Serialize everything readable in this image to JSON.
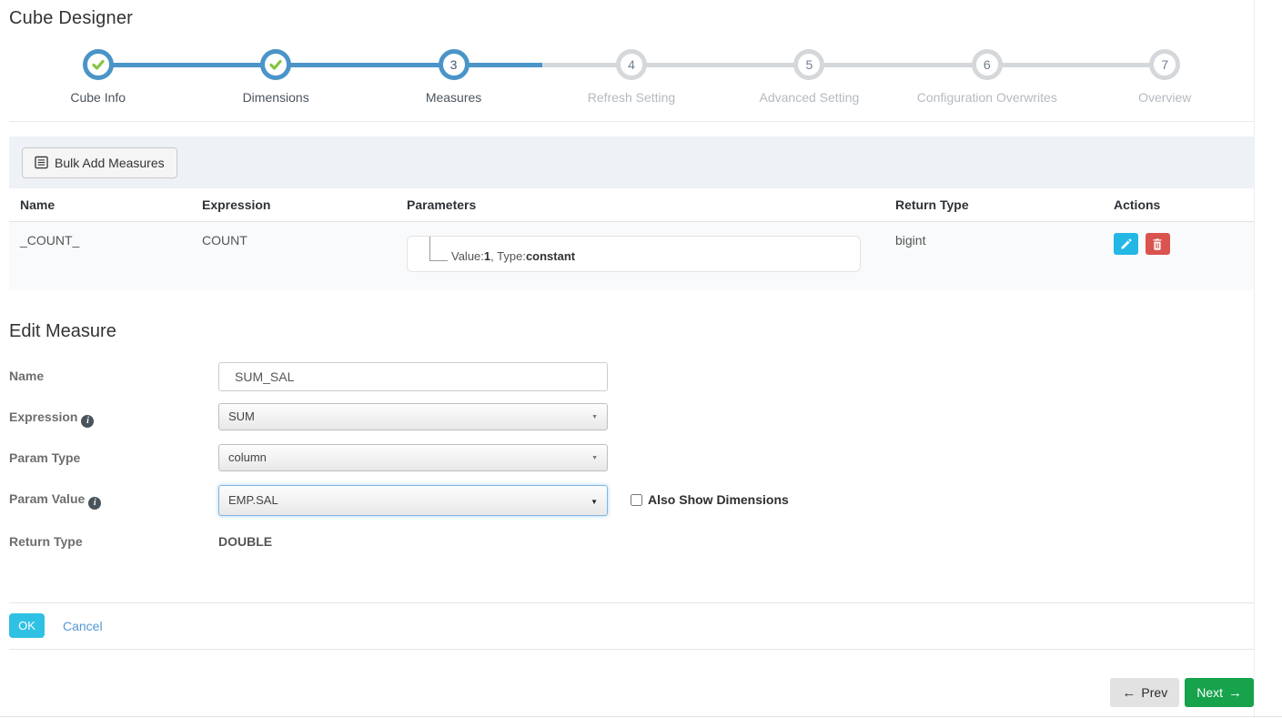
{
  "page": {
    "title": "Cube Designer"
  },
  "stepper": {
    "steps": [
      {
        "number": "1",
        "label": "Cube Info",
        "state": "completed"
      },
      {
        "number": "2",
        "label": "Dimensions",
        "state": "completed"
      },
      {
        "number": "3",
        "label": "Measures",
        "state": "active"
      },
      {
        "number": "4",
        "label": "Refresh Setting",
        "state": "upcoming"
      },
      {
        "number": "5",
        "label": "Advanced Setting",
        "state": "upcoming"
      },
      {
        "number": "6",
        "label": "Configuration Overwrites",
        "state": "upcoming"
      },
      {
        "number": "7",
        "label": "Overview",
        "state": "upcoming"
      }
    ]
  },
  "toolbar": {
    "bulk_add_label": "Bulk Add Measures"
  },
  "measures_table": {
    "columns": {
      "name": "Name",
      "expression": "Expression",
      "parameters": "Parameters",
      "return_type": "Return Type",
      "actions": "Actions"
    },
    "row": {
      "name": "_COUNT_",
      "expression": "COUNT",
      "parameters": {
        "value_label": "Value:",
        "value": "1",
        "type_label": ", Type:",
        "type": "constant"
      },
      "return_type": "bigint"
    }
  },
  "edit_measure": {
    "heading": "Edit Measure",
    "fields": {
      "name": {
        "label": "Name",
        "value": "SUM_SAL"
      },
      "expression": {
        "label": "Expression",
        "value": "SUM"
      },
      "param_type": {
        "label": "Param Type",
        "value": "column"
      },
      "param_value": {
        "label": "Param Value",
        "value": "EMP.SAL"
      },
      "return_type": {
        "label": "Return Type",
        "value": "DOUBLE"
      }
    },
    "also_show_dimensions_label": "Also Show Dimensions",
    "ok_label": "OK",
    "cancel_label": "Cancel",
    "info_icon_glyph": "i"
  },
  "footer": {
    "prev_label": "Prev",
    "next_label": "Next",
    "prev_arrow": "←",
    "next_arrow": "→"
  },
  "colors": {
    "stepper_blue": "#4a94c8",
    "stepper_gray": "#d5d8db",
    "check_green": "#85c440",
    "bulk_bar_bg": "#eef1f6",
    "row_bg": "#f9fafb",
    "edit_button": "#23b7e5",
    "delete_button": "#d9534f",
    "ok_button": "#2fc1e3",
    "cancel_link": "#5596d5",
    "next_button": "#17a24c",
    "prev_button": "#e2e2e2",
    "focus_border": "#7db6e4"
  }
}
